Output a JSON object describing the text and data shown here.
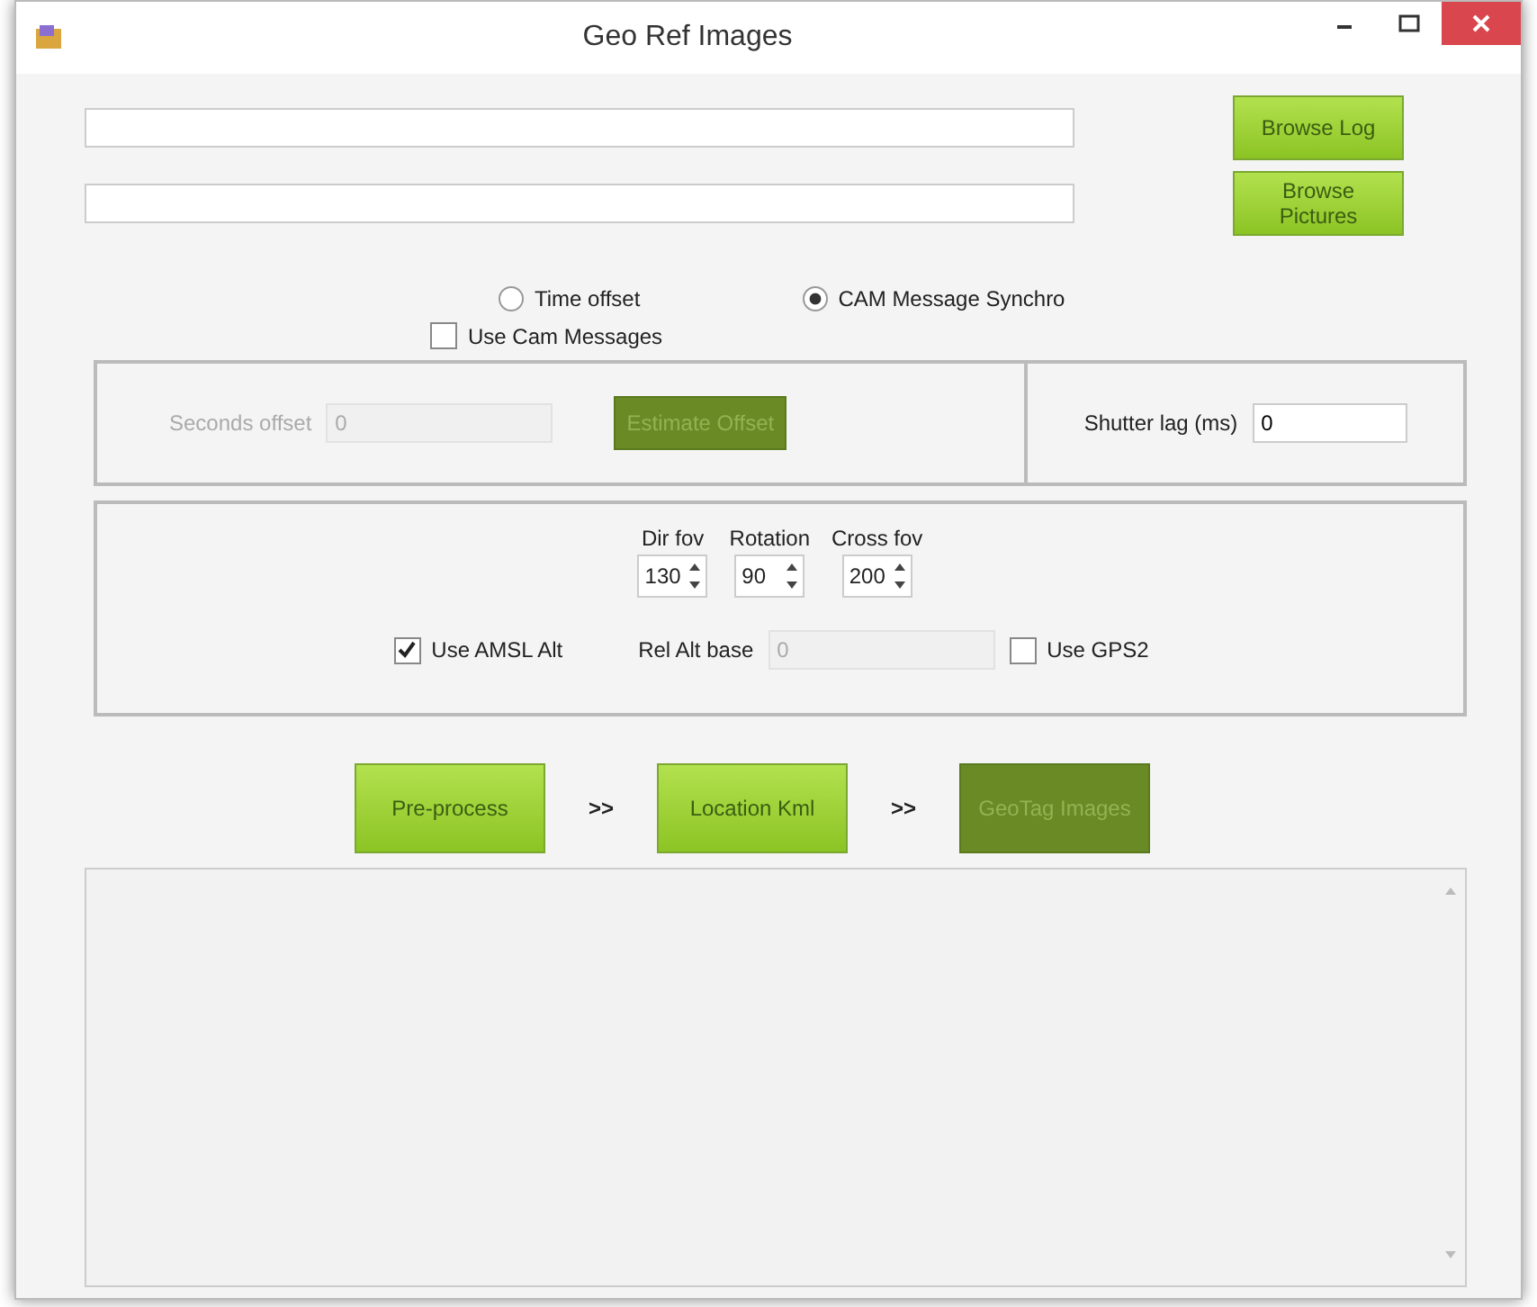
{
  "window": {
    "title": "Geo Ref Images"
  },
  "browse_buttons": [
    "Browse Log",
    "Browse Pictures"
  ],
  "sync_options": [
    {
      "label": "Time offset",
      "selected": false
    },
    {
      "label": "CAM Message Synchro",
      "selected": true
    }
  ],
  "use_cam_messages": {
    "label": "Use Cam Messages",
    "checked": false
  },
  "offset_panel": {
    "label": "Seconds offset",
    "value": "0",
    "button": "Estimate Offset",
    "disabled": true
  },
  "shutter_lag": {
    "label": "Shutter lag (ms)",
    "value": "0"
  },
  "spinners": [
    {
      "label": "Dir fov",
      "value": "130"
    },
    {
      "label": "Rotation",
      "value": "90"
    },
    {
      "label": "Cross fov",
      "value": "200"
    }
  ],
  "amsl": {
    "label": "Use AMSL Alt",
    "checked": true
  },
  "rel_alt": {
    "label": "Rel Alt base",
    "value": "0",
    "disabled": true
  },
  "gps2": {
    "label": "Use GPS2",
    "checked": false
  },
  "steps": [
    {
      "label": "Pre-process",
      "disabled": false,
      "next": ">>"
    },
    {
      "label": "Location Kml",
      "disabled": false,
      "next": ">>"
    },
    {
      "label": "GeoTag Images",
      "disabled": true
    }
  ]
}
